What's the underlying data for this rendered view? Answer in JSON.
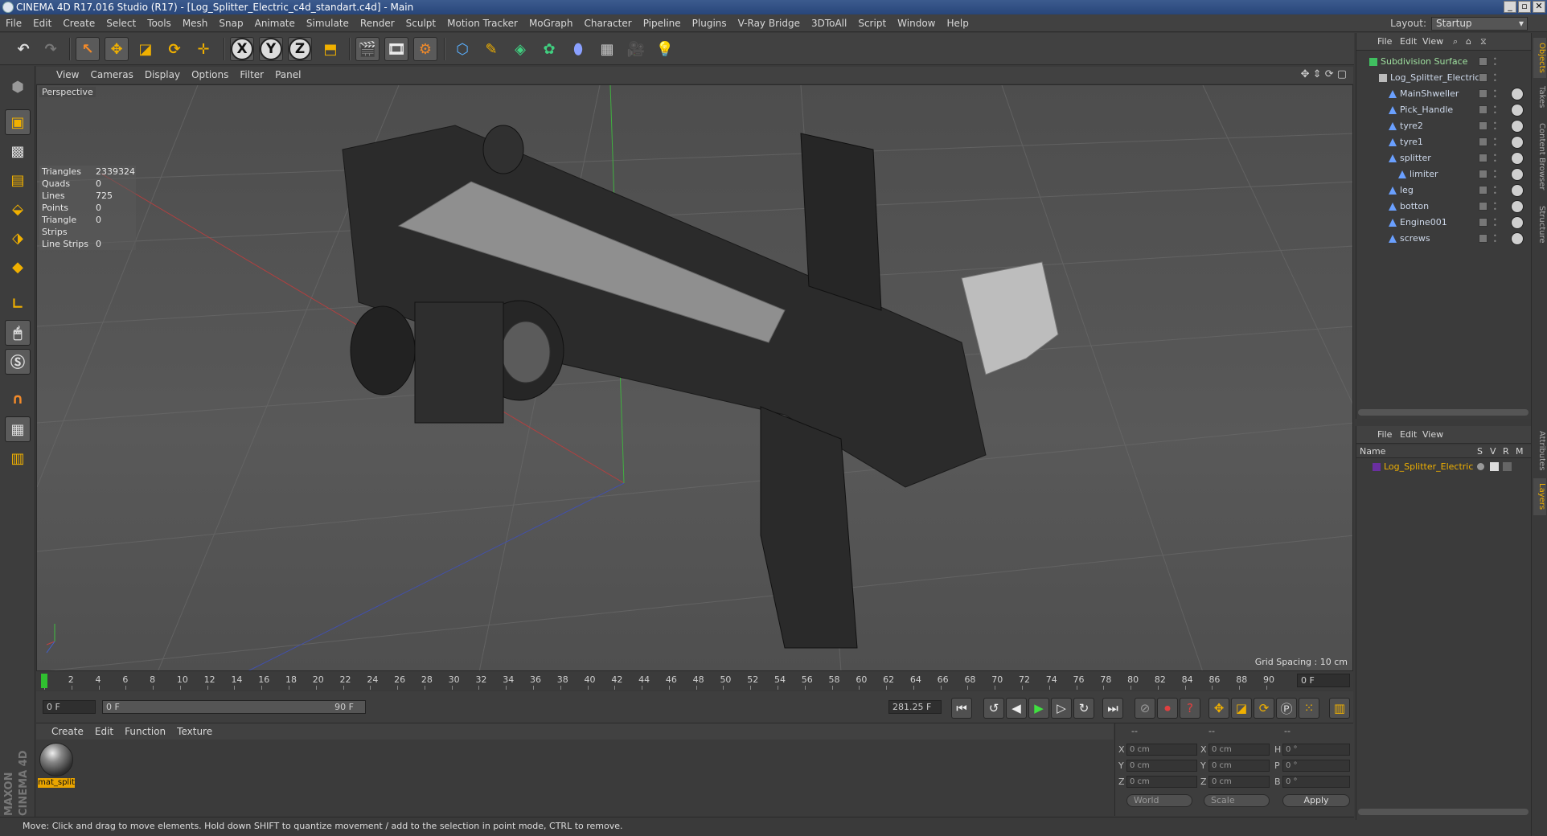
{
  "window": {
    "title": "CINEMA 4D R17.016 Studio (R17) - [Log_Splitter_Electric_c4d_standart.c4d] - Main"
  },
  "menu": [
    "File",
    "Edit",
    "Create",
    "Select",
    "Tools",
    "Mesh",
    "Snap",
    "Animate",
    "Simulate",
    "Render",
    "Sculpt",
    "Motion Tracker",
    "MoGraph",
    "Character",
    "Pipeline",
    "Plugins",
    "V-Ray Bridge",
    "3DToAll",
    "Script",
    "Window",
    "Help"
  ],
  "layout": {
    "label": "Layout:",
    "value": "Startup"
  },
  "toolbar": {
    "axis_x": "X",
    "axis_y": "Y",
    "axis_z": "Z"
  },
  "viewport": {
    "menu": [
      "View",
      "Cameras",
      "Display",
      "Options",
      "Filter",
      "Panel"
    ],
    "name": "Perspective",
    "grid_spacing": "Grid Spacing : 10 cm",
    "stats": [
      {
        "k": "Triangles",
        "v": "2339324"
      },
      {
        "k": "Quads",
        "v": "0"
      },
      {
        "k": "Lines",
        "v": "725"
      },
      {
        "k": "Points",
        "v": "0"
      },
      {
        "k": "Triangle Strips",
        "v": "0"
      },
      {
        "k": "Line Strips",
        "v": "0"
      }
    ]
  },
  "timeline": {
    "ticks": [
      "0",
      "2",
      "4",
      "6",
      "8",
      "10",
      "12",
      "14",
      "16",
      "18",
      "20",
      "22",
      "24",
      "26",
      "28",
      "30",
      "32",
      "34",
      "36",
      "38",
      "40",
      "42",
      "44",
      "46",
      "48",
      "50",
      "52",
      "54",
      "56",
      "58",
      "60",
      "62",
      "64",
      "66",
      "68",
      "70",
      "72",
      "74",
      "76",
      "78",
      "80",
      "82",
      "84",
      "86",
      "88",
      "90"
    ],
    "current": "0 F",
    "start": "0 F",
    "range_start": "0 F",
    "range_end": "90 F",
    "end": "281.25 F"
  },
  "material_manager": {
    "menu": [
      "Create",
      "Edit",
      "Function",
      "Texture"
    ],
    "materials": [
      {
        "name": "mat_split"
      }
    ]
  },
  "coordinates": {
    "header": [
      "--",
      "--",
      "--"
    ],
    "rows": [
      {
        "a": "X",
        "av": "0 cm",
        "b": "X",
        "bv": "0 cm",
        "c": "H",
        "cv": "0 °"
      },
      {
        "a": "Y",
        "av": "0 cm",
        "b": "Y",
        "bv": "0 cm",
        "c": "P",
        "cv": "0 °"
      },
      {
        "a": "Z",
        "av": "0 cm",
        "b": "Z",
        "bv": "0 cm",
        "c": "B",
        "cv": "0 °"
      }
    ],
    "world": "World",
    "scale": "Scale",
    "apply": "Apply"
  },
  "status": "Move: Click and drag to move elements. Hold down SHIFT to quantize movement / add to the selection in point mode, CTRL to remove.",
  "brand": "MAXON CINEMA 4D",
  "objects": {
    "menu": [
      "File",
      "Edit",
      "View"
    ],
    "items": [
      {
        "name": "Subdivision Surface",
        "depth": 0,
        "color": "#9fe09f"
      },
      {
        "name": "Log_Splitter_Electric",
        "depth": 1,
        "color": "#cdd8ea"
      },
      {
        "name": "MainShweller",
        "depth": 2,
        "color": "#cdd8ea"
      },
      {
        "name": "Pick_Handle",
        "depth": 2,
        "color": "#cdd8ea"
      },
      {
        "name": "tyre2",
        "depth": 2,
        "color": "#cdd8ea"
      },
      {
        "name": "tyre1",
        "depth": 2,
        "color": "#cdd8ea"
      },
      {
        "name": "splitter",
        "depth": 2,
        "color": "#cdd8ea"
      },
      {
        "name": "limiter",
        "depth": 3,
        "color": "#cdd8ea"
      },
      {
        "name": "leg",
        "depth": 2,
        "color": "#cdd8ea"
      },
      {
        "name": "botton",
        "depth": 2,
        "color": "#cdd8ea"
      },
      {
        "name": "Engine001",
        "depth": 2,
        "color": "#cdd8ea"
      },
      {
        "name": "screws",
        "depth": 2,
        "color": "#cdd8ea"
      }
    ]
  },
  "layers": {
    "menu": [
      "File",
      "Edit",
      "View"
    ],
    "col_name": "Name",
    "cols": [
      "S",
      "V",
      "R",
      "M"
    ],
    "items": [
      {
        "name": "Log_Splitter_Electric"
      }
    ]
  },
  "right_tabs": [
    "Objects",
    "Takes",
    "Content Browser",
    "Structure",
    "Attributes",
    "Layers"
  ]
}
